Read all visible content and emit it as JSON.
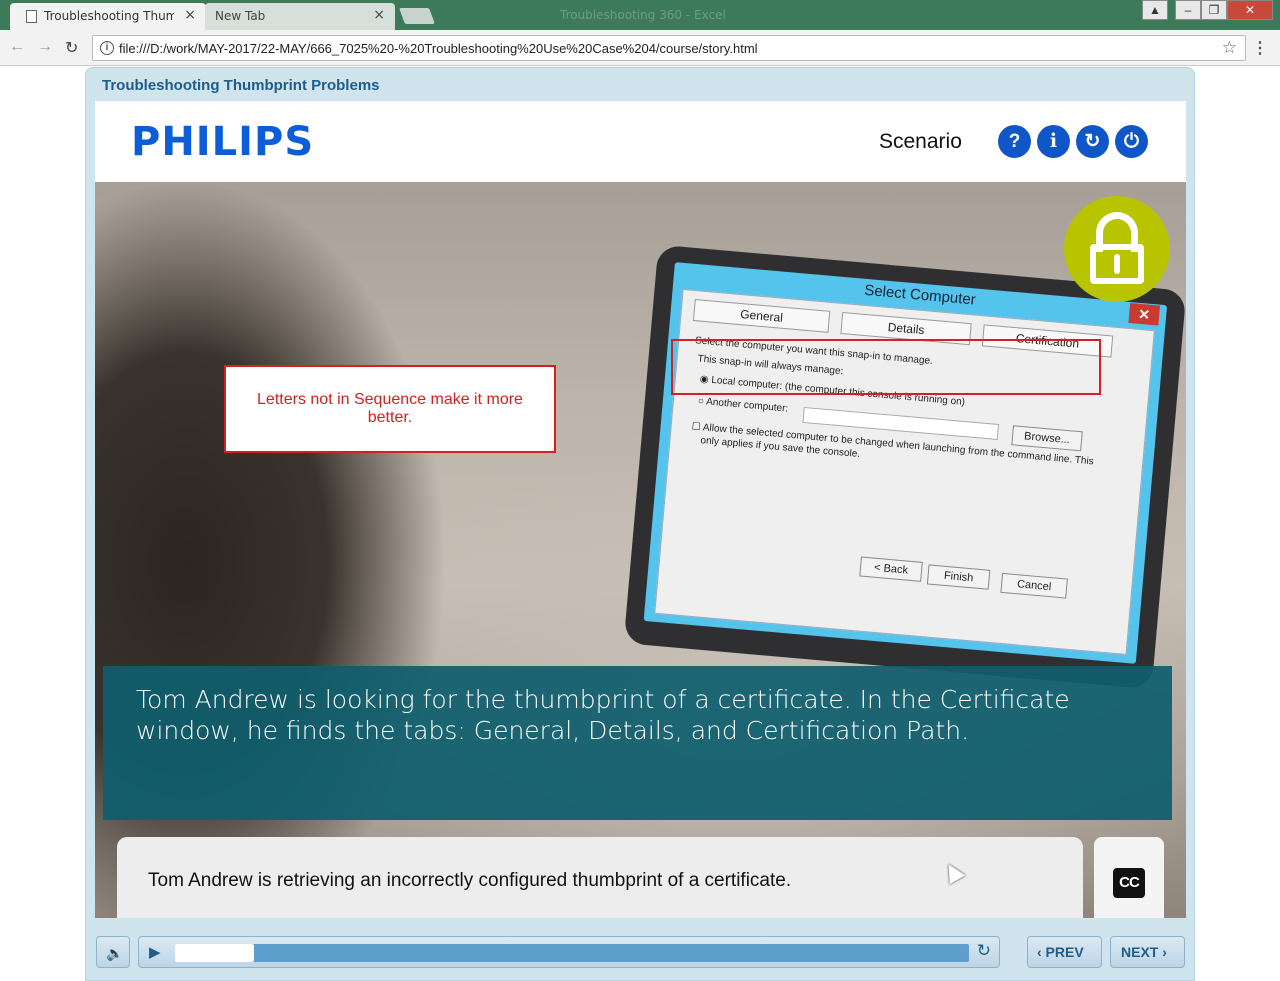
{
  "browser": {
    "window_title": "Troubleshooting 360 - Excel",
    "tabs": [
      {
        "label": "Troubleshooting Thumbprint",
        "close": "×"
      },
      {
        "label": "New Tab",
        "close": "×"
      }
    ],
    "url": "file:///D:/work/MAY-2017/22-MAY/666_7025%20-%20Troubleshooting%20Use%20Case%204/course/story.html",
    "back_icon": "←",
    "forward_icon": "→",
    "reload_icon": "↻",
    "info_icon": "i",
    "star_icon": "☆",
    "menu_icon": "⋮",
    "window_controls": [
      "▲",
      "–",
      "❐",
      "✕"
    ]
  },
  "course": {
    "title": "Troubleshooting Thumbprint Problems",
    "logo": "PHILIPS",
    "section_label": "Scenario",
    "header_buttons": [
      "?",
      "i",
      "↻",
      "⏻"
    ],
    "dialog": {
      "title": "Select Computer",
      "close": "✕",
      "tabs": [
        "General",
        "Details",
        "Certification"
      ],
      "lines": [
        "Select the computer you want this snap-in to manage.",
        "This snap-in will always manage:",
        "◉ Local computer:  (the computer this console is running on)",
        "○ Another computer:",
        "☐ Allow the selected computer to be changed when launching from the command line.  This",
        "only applies if you save the console."
      ],
      "browse": "Browse...",
      "buttons": [
        "< Back",
        "Finish",
        "Cancel"
      ]
    },
    "callout": "Letters not in Sequence make it more better.",
    "narration": "Tom Andrew is looking for the thumbprint of a certificate. In the Certificate window, he finds the tabs: General, Details, and Certification Path.",
    "caption": "Tom Andrew is retrieving an incorrectly configured thumbprint of a certificate.",
    "cc_label": "CC"
  },
  "controls": {
    "volume_icon": "🔈",
    "play_icon": "▶",
    "replay_icon": "↻",
    "progress": 0.1,
    "prev_label": "‹ PREV",
    "next_label": "NEXT ›"
  },
  "colors": {
    "accent": "#0f56c9",
    "teal_panel": "#0f5e6d",
    "lock_badge": "#b8c400",
    "callout_red": "#d42020"
  }
}
